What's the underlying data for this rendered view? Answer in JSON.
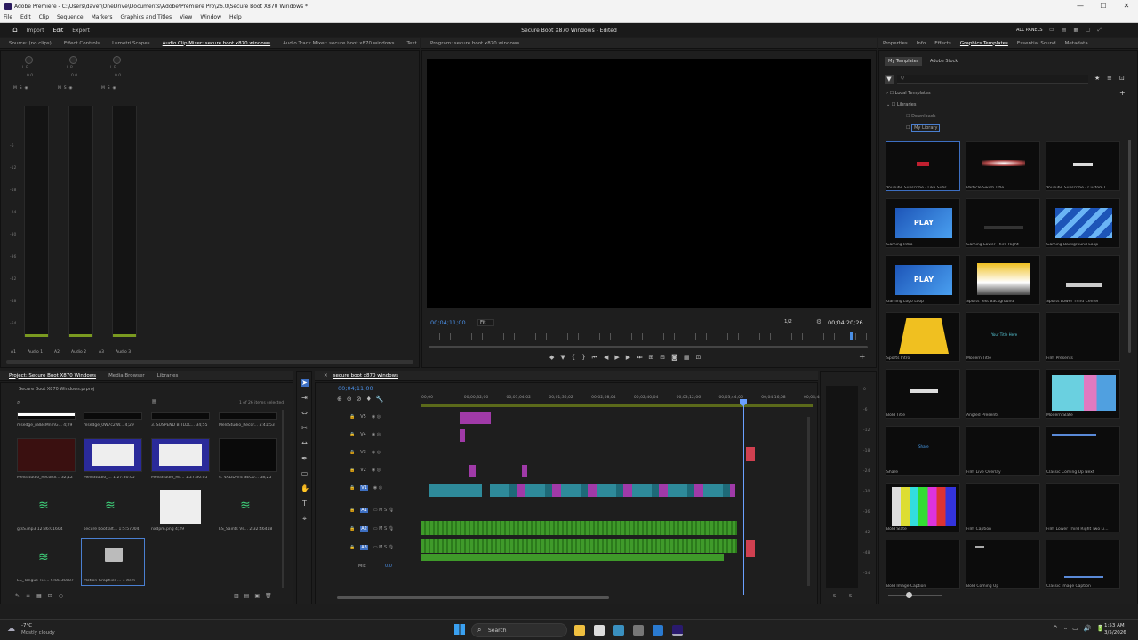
{
  "window": {
    "title": "Adobe Premiere - C:\\Users\\davef\\OneDrive\\Documents\\Adobe\\Premiere Pro\\26.0\\Secure Boot X870 Windows *",
    "controls": [
      "—",
      "☐",
      "✕"
    ]
  },
  "menu": [
    "File",
    "Edit",
    "Clip",
    "Sequence",
    "Markers",
    "Graphics and Titles",
    "View",
    "Window",
    "Help"
  ],
  "appbar": {
    "tabs": [
      "Import",
      "Edit",
      "Export"
    ],
    "active": "Edit",
    "document": "Secure Boot X870 Windows - Edited",
    "all_panels": "ALL PANELS"
  },
  "source_panel": {
    "tabs": [
      "Source: (no clips)",
      "Effect Controls",
      "Lumetri Scopes",
      "Audio Clip Mixer: secure boot x870 windows",
      "Audio Track Mixer: secure boot x870 windows",
      "Text"
    ],
    "active": "Audio Clip Mixer: secure boot x870 windows",
    "channels": [
      {
        "id": "A1",
        "name": "Audio 1",
        "knob": "L R",
        "value": "0.0"
      },
      {
        "id": "A2",
        "name": "Audio 2",
        "knob": "L R",
        "value": "0.0"
      },
      {
        "id": "A3",
        "name": "Audio 3",
        "knob": "L R",
        "value": "0.0"
      }
    ],
    "db_scale": [
      "-6",
      "-12",
      "-18",
      "-24",
      "-30",
      "-36",
      "-42",
      "-48",
      "-54"
    ]
  },
  "program": {
    "tab": "Program: secure boot x870 windows",
    "timecode_in": "00;04;11;00",
    "fit": "Fit",
    "resolution": "1/2",
    "timecode_out": "00;04;20;26"
  },
  "project": {
    "tabs": [
      "Project: Secure Boot X870 Windows",
      "Media Browser",
      "Libraries"
    ],
    "file": "Secure Boot X870 Windows.prproj",
    "selection": "1 of 26 items selected",
    "items": [
      {
        "name": "msedge_n8B4MnmG...",
        "dur": "4;29"
      },
      {
        "name": "msedge_0W7c2iW...",
        "dur": "4;29"
      },
      {
        "name": "3. SUSPEND BITLOC...",
        "dur": "34;55"
      },
      {
        "name": "MeldStudio_Recor...",
        "dur": "5:41:53"
      },
      {
        "name": "MeldStudio_Recordi...",
        "dur": "32;12"
      },
      {
        "name": "MeldStudio_...",
        "dur": "1:27:30:05"
      },
      {
        "name": "MeldStudio_Re...",
        "dur": "1:27:30:05"
      },
      {
        "name": "4. VALIDATE SECU...",
        "dur": "58;25"
      },
      {
        "name": "gtsS.mp3",
        "dur": "12:36:01604"
      },
      {
        "name": "secure boot alt...",
        "dur": "1:5:57004"
      },
      {
        "name": "nxdpm.png",
        "dur": "4;29"
      },
      {
        "name": "ES_Saints Vs...",
        "dur": "2:32:46418"
      },
      {
        "name": "ES_Tongue Tie...",
        "dur": "5:56:35587"
      },
      {
        "name": "Motion Graphics ...",
        "dur": "1 item"
      }
    ]
  },
  "timeline": {
    "tab": "secure boot x870 windows",
    "timecode": "00;04;11;00",
    "ruler": [
      "00;00",
      "00;00;32;00",
      "00;01;04;02",
      "00;01;36;02",
      "00;02;08;04",
      "00;02;40;04",
      "00;03;12;06",
      "00;03;44;06",
      "00;04;16;08",
      "00;04;48;08"
    ],
    "video_tracks": [
      "V5",
      "V4",
      "V3",
      "V2",
      "V1"
    ],
    "audio_tracks": [
      "A1",
      "A2",
      "A3"
    ],
    "mix": "Mix",
    "mix_value": "0.0",
    "meter_scale": [
      "0",
      "-6",
      "-12",
      "-18",
      "-24",
      "-30",
      "-36",
      "-42",
      "-48",
      "-54"
    ],
    "meter_labels": [
      "S",
      "S"
    ]
  },
  "right_panel": {
    "tabs": [
      "Properties",
      "Info",
      "Effects",
      "Graphics Templates",
      "Essential Sound",
      "Metadata"
    ],
    "active": "Graphics Templates",
    "subtabs": [
      "My Templates",
      "Adobe Stock"
    ],
    "search_placeholder": "Q",
    "tree": [
      {
        "label": "Local Templates",
        "expanded": false
      },
      {
        "label": "Libraries",
        "expanded": true
      },
      {
        "label": "Downloads",
        "expanded": false
      },
      {
        "label": "My Library",
        "expanded": false
      }
    ],
    "templates": [
      "YouTube Subscribe - Like Subs...",
      "Particle Swish Title",
      "YouTube Subscribe - Custom L...",
      "Gaming Intro",
      "Gaming Lower Third Right",
      "Gaming Background Loop",
      "Gaming Logo Loop",
      "Sports Text Background",
      "Sports Lower Third Center",
      "Sports Intro",
      "Modern Title",
      "Film Presents",
      "Bold Title",
      "Angled Presents",
      "Modern Slate",
      "Share",
      "Film Live Overlay",
      "Classic Coming Up Next",
      "Bold Slate",
      "Film Caption",
      "Film Lower Third Right Two Li...",
      "Bold Image Caption",
      "Bold Coming Up",
      "Classic Image Caption"
    ],
    "thumb_text": {
      "play": "PLAY",
      "your_title": "Your Title Here",
      "share": "Share"
    }
  },
  "taskbar": {
    "weather_temp": "-7°C",
    "weather": "Mostly cloudy",
    "search": "Search",
    "time": "1:53 AM",
    "date": "3/5/2026"
  },
  "colors": {
    "accent": "#4a7fd1",
    "video_clip": "#2e8a9a",
    "magenta_clip": "#a03aa8",
    "audio_clip": "#3f9a2a",
    "playhead": "#6aa0ff"
  }
}
